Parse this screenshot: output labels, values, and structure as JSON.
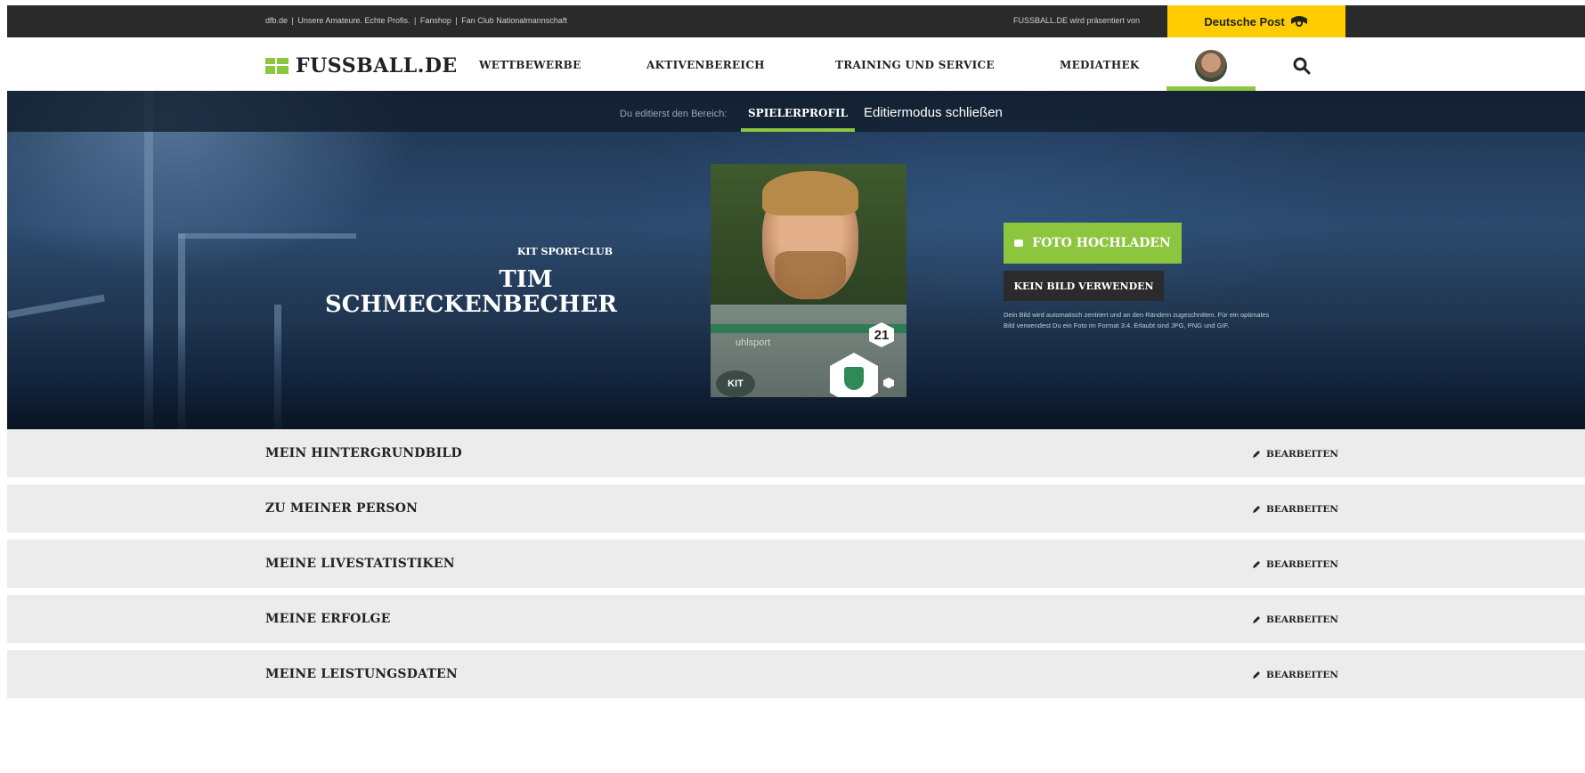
{
  "topbar": {
    "links": [
      "dfb.de",
      "|",
      "Unsere Amateure. Echte Profis.",
      "|",
      "Fanshop",
      "|",
      "Fan Club Nationalmannschaft"
    ],
    "presented_by": "FUSSBALL.DE wird präsentiert von",
    "sponsor": "Deutsche Post"
  },
  "nav": {
    "logo_text": "FUSSBALL.DE",
    "items": [
      {
        "label": "WETTBEWERBE"
      },
      {
        "label": "AKTIVENBEREICH"
      },
      {
        "label": "TRAINING UND SERVICE"
      },
      {
        "label": "MEDIATHEK"
      }
    ],
    "avatar": "user-avatar",
    "search_icon": "search-icon"
  },
  "editbar": {
    "label": "Du editierst den Bereich:",
    "section": "SPIELERPROFIL",
    "close": "Editiermodus schließen"
  },
  "profile": {
    "club": "KIT SPORT-CLUB",
    "first_name": "TIM",
    "last_name": "SCHMECKENBECHER",
    "jersey_number": "21",
    "photo_sponsor": "uhlsport",
    "badge": "KIT"
  },
  "actions": {
    "upload_label": "FOTO HOCHLADEN",
    "no_image_label": "KEIN BILD VERWENDEN",
    "hint": "Dein Bild wird automatisch zentriert und an den Rändern zugeschnitten. Für ein optimales Bild verwendest Du ein Foto im Format 3:4. Erlaubt sind JPG, PNG und GIF."
  },
  "sections": [
    {
      "title": "MEIN HINTERGRUNDBILD",
      "edit": "BEARBEITEN"
    },
    {
      "title": "ZU MEINER PERSON",
      "edit": "BEARBEITEN"
    },
    {
      "title": "MEINE LIVESTATISTIKEN",
      "edit": "BEARBEITEN"
    },
    {
      "title": "MEINE ERFOLGE",
      "edit": "BEARBEITEN"
    },
    {
      "title": "MEINE LEISTUNGSDATEN",
      "edit": "BEARBEITEN"
    }
  ],
  "colors": {
    "accent": "#8cc63f",
    "sponsor_yellow": "#ffcc00",
    "topbar": "#2a2a2a",
    "section_bg": "#ececec"
  }
}
